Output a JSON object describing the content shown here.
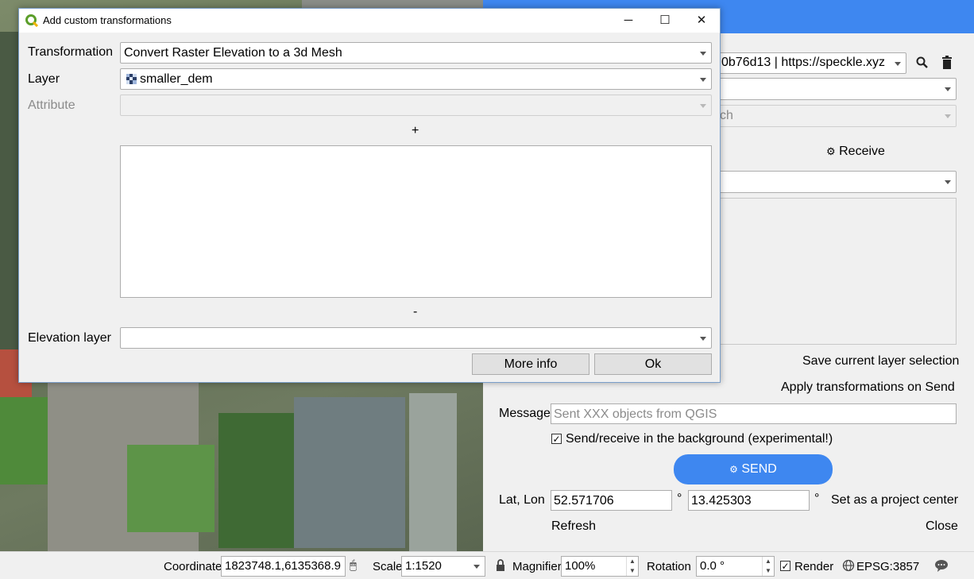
{
  "dialog": {
    "title": "Add custom transformations",
    "transformation_label": "Transformation",
    "transformation_value": "Convert Raster Elevation to a 3d Mesh",
    "layer_label": "Layer",
    "layer_value": "smaller_dem",
    "attribute_label": "Attribute",
    "plus_label": "+",
    "minus_label": "-",
    "elevation_label": "Elevation layer",
    "more_info_label": "More info",
    "ok_label": "Ok",
    "minimize_glyph": "─",
    "maximize_glyph": "☐",
    "close_glyph": "✕"
  },
  "panel": {
    "server_value": "0b76d13 | https://speckle.xyz",
    "branch_placeholder": "ch",
    "receive_label": "Receive",
    "save_selection_label": "Save current layer selection",
    "apply_transformations_label": "Apply transformations on Send",
    "message_label": "Message",
    "message_placeholder": "Sent XXX objects from QGIS",
    "background_label": "Send/receive in the background (experimental!)",
    "background_checked": "✓",
    "send_label": "SEND",
    "latlon_label": "Lat, Lon",
    "lat_value": "52.571706",
    "lon_value": "13.425303",
    "degree": "°",
    "set_center_label": "Set as a project center",
    "refresh_label": "Refresh",
    "close_label": "Close",
    "accent_color": "#3e87f0"
  },
  "statusbar": {
    "coordinate_label": "Coordinate",
    "coordinate_value": "1823748.1,6135368.9",
    "scale_label": "Scale",
    "scale_value": "1:1520",
    "magnifier_label": "Magnifier",
    "magnifier_value": "100%",
    "rotation_label": "Rotation",
    "rotation_value": "0.0 °",
    "render_label": "Render",
    "render_checked": "✓",
    "crs_label": "EPSG:3857"
  }
}
